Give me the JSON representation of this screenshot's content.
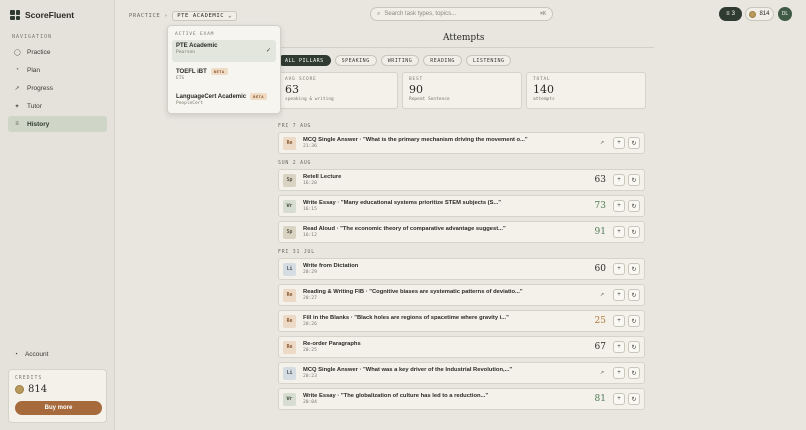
{
  "brand": {
    "name": "ScoreFluent"
  },
  "sidebar": {
    "heading": "NAVIGATION",
    "items": [
      {
        "label": "Practice",
        "icon": "◯"
      },
      {
        "label": "Plan",
        "icon": "◔"
      },
      {
        "label": "Progress",
        "icon": "↗"
      },
      {
        "label": "Tutor",
        "icon": "✦"
      },
      {
        "label": "History",
        "icon": "≡"
      }
    ],
    "active_index": 4,
    "account_label": "Account",
    "account_icon": "◔",
    "credits_label": "CREDITS",
    "credits_value": "814",
    "buy_label": "Buy more"
  },
  "topbar": {
    "crumb_root": "PRACTICE",
    "crumb_sep": "›",
    "exam": "PTE ACADEMIC",
    "exam_caret": "⌄",
    "search_icon": "⌕",
    "search_placeholder": "Search task types, topics...",
    "search_kbd": "⌘K",
    "streak_icon": "≡",
    "streak": "3",
    "coins": "814",
    "avatar": "DL"
  },
  "dropdown": {
    "heading": "ACTIVE EXAM",
    "items": [
      {
        "name": "PTE Academic",
        "sub": "Pearson",
        "beta": "",
        "selected": true
      },
      {
        "name": "TOEFL iBT",
        "sub": "ETS",
        "beta": "BETA",
        "selected": false
      },
      {
        "name": "LanguageCert Academic",
        "sub": "PeopleCert",
        "beta": "BETA",
        "selected": false
      }
    ],
    "check": "✓"
  },
  "main": {
    "title": "Attempts",
    "tabs": [
      "ALL PILLARS",
      "SPEAKING",
      "WRITING",
      "READING",
      "LISTENING"
    ],
    "active_tab": 0,
    "stats": [
      {
        "label": "AVG SCORE",
        "value": "63",
        "sub": "speaking & writing"
      },
      {
        "label": "BEST",
        "value": "90",
        "sub": "Repeat Sentence"
      },
      {
        "label": "TOTAL",
        "value": "140",
        "sub": "attempts"
      }
    ],
    "groups": [
      {
        "day": "FRI 7 AUG",
        "rows": [
          {
            "code": "Re",
            "title": "MCQ Single Answer · \"What is the primary mechanism driving the movement o...\"",
            "time": "21:36",
            "score": "",
            "icon": "↗",
            "tone": "dark"
          }
        ]
      },
      {
        "day": "SUN 2 AUG",
        "rows": [
          {
            "code": "Sp",
            "title": "Retell Lecture",
            "time": "16:20",
            "score": "63",
            "icon": "",
            "tone": "dark"
          },
          {
            "code": "Wr",
            "title": "Write Essay · \"Many educational systems prioritize STEM subjects (S...\"",
            "time": "16:15",
            "score": "73",
            "icon": "",
            "tone": "green"
          },
          {
            "code": "Sp",
            "title": "Read Aloud · \"The economic theory of comparative advantage suggest...\"",
            "time": "16:12",
            "score": "91",
            "icon": "",
            "tone": "green"
          }
        ]
      },
      {
        "day": "FRI 31 JUL",
        "rows": [
          {
            "code": "Li",
            "title": "Write from Dictation",
            "time": "20:29",
            "score": "60",
            "icon": "",
            "tone": "dark"
          },
          {
            "code": "Re",
            "title": "Reading & Writing FIB · \"Cognitive biases are systematic patterns of deviatio...\"",
            "time": "20:27",
            "score": "",
            "icon": "↗",
            "tone": "dark"
          },
          {
            "code": "Re",
            "title": "Fill in the Blanks · \"Black holes are regions of spacetime where gravity i...\"",
            "time": "20:26",
            "score": "25",
            "icon": "",
            "tone": "amber"
          },
          {
            "code": "Re",
            "title": "Re-order Paragraphs",
            "time": "20:25",
            "score": "67",
            "icon": "",
            "tone": "dark"
          },
          {
            "code": "Li",
            "title": "MCQ Single Answer · \"What was a key driver of the Industrial Revolution,...\"",
            "time": "20:23",
            "score": "",
            "icon": "↗",
            "tone": "dark"
          },
          {
            "code": "Wr",
            "title": "Write Essay · \"The globalization of culture has led to a reduction...\"",
            "time": "20:04",
            "score": "81",
            "icon": "",
            "tone": "green"
          }
        ]
      }
    ],
    "btn_add": "+",
    "btn_retry": "↻"
  }
}
